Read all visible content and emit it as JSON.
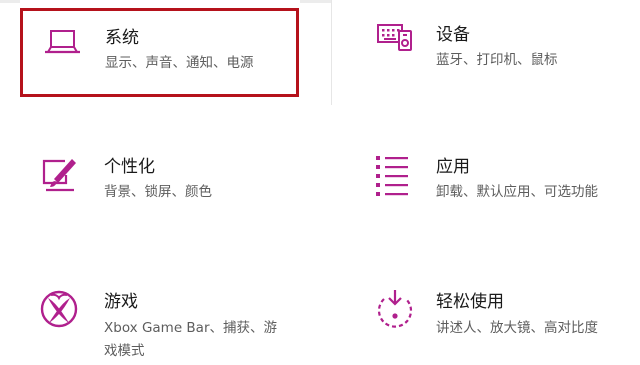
{
  "colors": {
    "accent": "#b0208d",
    "selection_border": "#b5121b"
  },
  "tiles": [
    {
      "id": "system",
      "title": "系统",
      "description": "显示、声音、通知、电源",
      "icon": "laptop-icon",
      "selected": true
    },
    {
      "id": "devices",
      "title": "设备",
      "description": "蓝牙、打印机、鼠标",
      "icon": "devices-icon",
      "selected": false
    },
    {
      "id": "personalization",
      "title": "个性化",
      "description": "背景、锁屏、颜色",
      "icon": "paint-brush-icon",
      "selected": false
    },
    {
      "id": "apps",
      "title": "应用",
      "description": "卸载、默认应用、可选功能",
      "icon": "apps-list-icon",
      "selected": false
    },
    {
      "id": "gaming",
      "title": "游戏",
      "description": "Xbox Game Bar、捕获、游\n戏模式",
      "icon": "xbox-icon",
      "selected": false
    },
    {
      "id": "ease-of-access",
      "title": "轻松使用",
      "description": "讲述人、放大镜、高对比度",
      "icon": "ease-of-access-icon",
      "selected": false
    }
  ]
}
